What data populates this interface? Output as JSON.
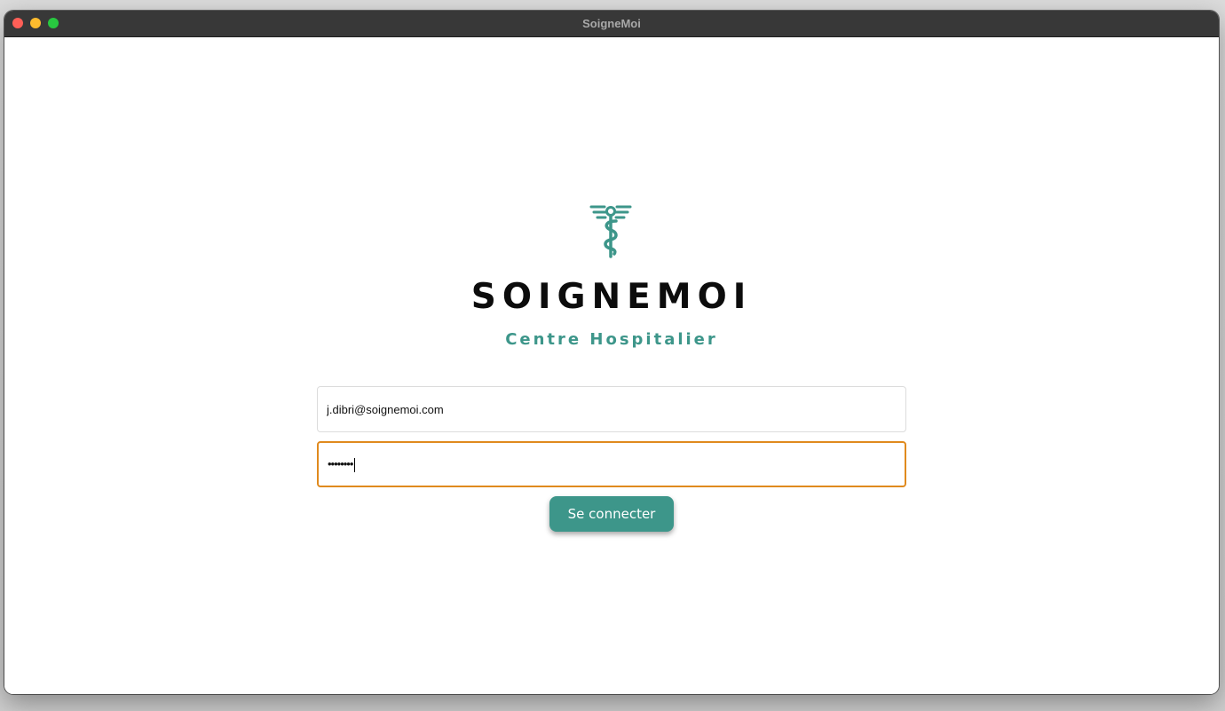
{
  "window": {
    "title": "SoigneMoi"
  },
  "brand": {
    "name": "SOIGNEMOI",
    "tagline": "Centre Hospitalier",
    "logo_icon": "caduceus-icon",
    "accent_color": "#3d968a"
  },
  "login_form": {
    "email_value": "j.dibri@soignemoi.com",
    "password_masked": "••••••••",
    "submit_label": "Se connecter",
    "focus_color": "#e08a1e"
  }
}
